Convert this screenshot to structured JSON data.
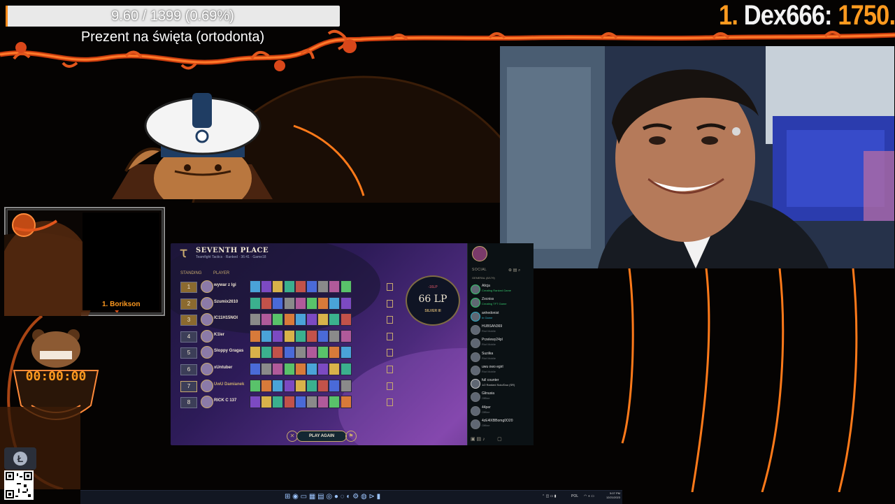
{
  "goal": {
    "progress_text": "9.60 / 1399 (0.69%)",
    "progress_fraction": 0.0069,
    "title": "Prezent na święta (ortodonta)"
  },
  "top_donor": {
    "rank": "1.",
    "name": "Dex666:",
    "amount": "1750."
  },
  "mini_cam": {
    "label": "1. Borikson"
  },
  "timer": {
    "value": "00:00:00"
  },
  "client": {
    "title": "SEVENTH PLACE",
    "meta": [
      "Teamfight Tactics",
      "Ranked",
      "36:41",
      "Game18"
    ],
    "col_standing": "STANDING",
    "col_player": "PLAYER",
    "lp": "66 LP",
    "lp_delta": "-16LP",
    "tier": "SILVER III",
    "play_again": "PLAY AGAIN",
    "rows": [
      {
        "place": "1",
        "name": "wywar z lgi"
      },
      {
        "place": "2",
        "name": "Szumix2610"
      },
      {
        "place": "3",
        "name": "IC11H15NOI"
      },
      {
        "place": "4",
        "name": "K1ler"
      },
      {
        "place": "5",
        "name": "Sloppy Gragas"
      },
      {
        "place": "6",
        "name": "xUntuber"
      },
      {
        "place": "7",
        "name": "UwU Damianek"
      },
      {
        "place": "8",
        "name": "RICK C 137"
      }
    ]
  },
  "social": {
    "header": "SOCIAL",
    "group": "GENERAL (8/179)",
    "friends": [
      {
        "name": "Alicja",
        "status": "Creating Ranked Game",
        "color": "#35c46b"
      },
      {
        "name": "Zocniss",
        "status": "Creating TFT Game",
        "color": "#35c46b"
      },
      {
        "name": "anhedonist",
        "status": "In Game",
        "color": "#2fb0c8"
      },
      {
        "name": "HUBSAN369",
        "status": "Riot Mobile",
        "color": "#6d7378"
      },
      {
        "name": "Przelewy24pl",
        "status": "Riot Mobile",
        "color": "#6d7378"
      },
      {
        "name": "Suziika",
        "status": "Riot Mobile",
        "color": "#6d7378"
      },
      {
        "name": "uwu owo egirl",
        "status": "Riot Mobile",
        "color": "#6d7378"
      },
      {
        "name": "full counter",
        "status": "1/2 Ranked Solo/Duo (SR)",
        "color": "#c9c9c9"
      },
      {
        "name": "Glinusia",
        "status": "Offline",
        "color": "#6d7378"
      },
      {
        "name": "44per",
        "status": "Offline",
        "color": "#6d7378"
      },
      {
        "name": "4zE4lXBBomg0O20",
        "status": "Offline",
        "color": "#6d7378"
      }
    ]
  },
  "taskbar": {
    "lang": "POL",
    "time": "5:07 PM",
    "date": "12/21/2023"
  },
  "colors": {
    "accent": "#ff8b1a",
    "client_gold": "#c8aa6e"
  }
}
